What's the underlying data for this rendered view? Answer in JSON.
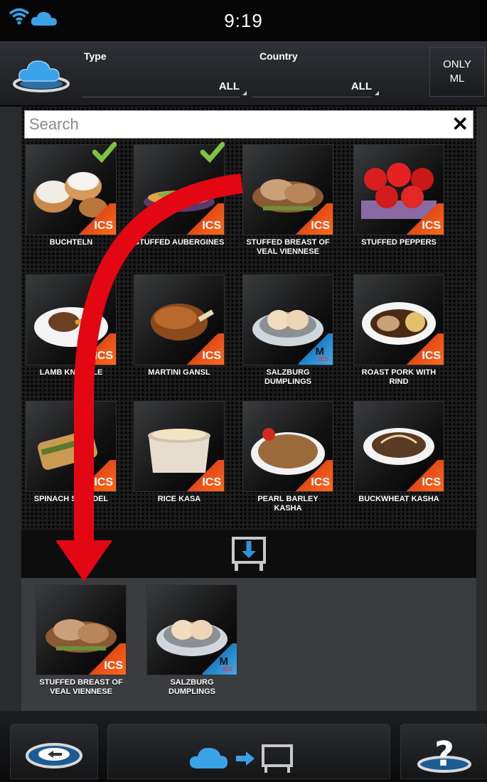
{
  "status": {
    "time": "9:19"
  },
  "filters": {
    "type_label": "Type",
    "type_value": "ALL",
    "country_label": "Country",
    "country_value": "ALL",
    "only_ml_label": "ONLY\nML"
  },
  "search": {
    "placeholder": "Search",
    "value": ""
  },
  "recipes": [
    {
      "name": "BUCHTELN",
      "badge": "ICS",
      "checked": true
    },
    {
      "name": "STUFFED AUBERGINES",
      "badge": "ICS",
      "checked": true
    },
    {
      "name": "STUFFED BREAST OF\nVEAL VIENNESE",
      "badge": "ICS",
      "checked": false
    },
    {
      "name": "STUFFED PEPPERS",
      "badge": "ICS",
      "checked": false
    },
    {
      "name": "LAMB KNUCKLE",
      "badge": "ICS",
      "checked": false
    },
    {
      "name": "MARTINI GANSL",
      "badge": "ICS",
      "checked": false
    },
    {
      "name": "SALZBURG\nDUMPLINGS",
      "badge": "ML",
      "checked": false
    },
    {
      "name": "ROAST PORK WITH\nRIND",
      "badge": "ICS",
      "checked": false
    },
    {
      "name": "SPINACH STRUDEL",
      "badge": "ICS",
      "checked": false
    },
    {
      "name": "RICE KASA",
      "badge": "ICS",
      "checked": false
    },
    {
      "name": "PEARL BARLEY\nKASHA",
      "badge": "ICS",
      "checked": false
    },
    {
      "name": "BUCKWHEAT KASHA",
      "badge": "ICS",
      "checked": false
    }
  ],
  "selected": [
    {
      "name": "STUFFED BREAST OF\nVEAL VIENNESE",
      "badge": "ICS"
    },
    {
      "name": "SALZBURG\nDUMPLINGS",
      "badge": "ML"
    }
  ],
  "badges": {
    "ics": "ICS",
    "ml": "M"
  },
  "colors": {
    "accent_orange": "#ff6a1c",
    "ml_blue": "#2f95d8",
    "check_green": "#7cc243",
    "arrow_red": "#e30613",
    "cloud_blue": "#3aa3e8"
  },
  "icons": [
    "wifi-icon",
    "cloud-icon",
    "cloud-logo-icon",
    "clear-icon",
    "check-icon",
    "download-to-device-icon",
    "back-icon",
    "cloud-to-device-icon",
    "help-icon"
  ]
}
